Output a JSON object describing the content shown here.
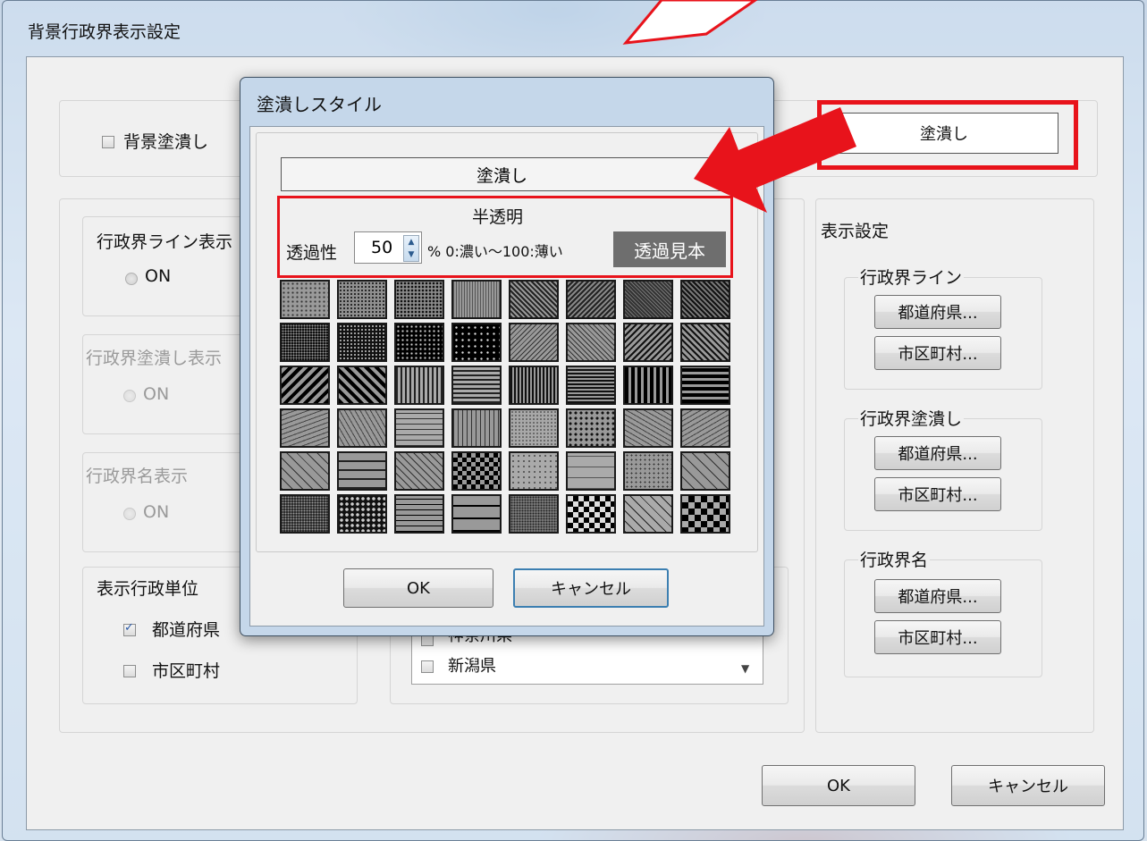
{
  "main_window": {
    "title": "背景行政界表示設定",
    "bg_fill_checkbox": "背景塗潰し",
    "fill_button": "塗潰し",
    "line_display": {
      "title": "行政界ライン表示",
      "on": "ON"
    },
    "fill_display": {
      "title": "行政界塗潰し表示",
      "on": "ON"
    },
    "name_display": {
      "title": "行政界名表示",
      "on": "ON"
    },
    "unit": {
      "title": "表示行政単位",
      "prefecture": "都道府県",
      "municipality": "市区町村",
      "prefecture_checked": true,
      "municipality_checked": false
    },
    "pref_list": [
      "神奈川県",
      "新潟県"
    ],
    "display_settings": {
      "title": "表示設定",
      "line": {
        "title": "行政界ライン",
        "pref": "都道府県...",
        "muni": "市区町村..."
      },
      "fill": {
        "title": "行政界塗潰し",
        "pref": "都道府県...",
        "muni": "市区町村..."
      },
      "name": {
        "title": "行政界名",
        "pref": "都道府県...",
        "muni": "市区町村..."
      }
    },
    "ok": "OK",
    "cancel": "キャンセル"
  },
  "dialog": {
    "title": "塗潰しスタイル",
    "fill_label": "塗潰し",
    "semi_transparent": "半透明",
    "transparency_label": "透過性",
    "transparency_value": "50",
    "unit_hint": "% 0:濃い〜100:薄い",
    "sample_button": "透過見本",
    "ok": "OK",
    "cancel": "キャンセル",
    "pattern_rows": 6,
    "pattern_cols": 8
  },
  "colors": {
    "annotation_red": "#e8131b",
    "sample_button_bg": "#6e6e6e"
  }
}
